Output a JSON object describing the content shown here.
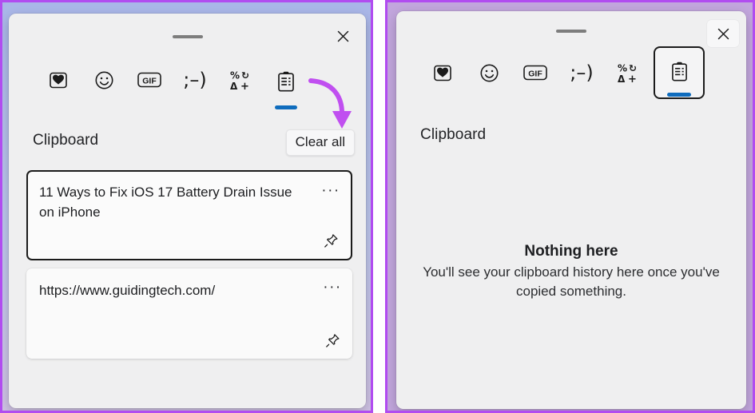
{
  "theme": {
    "accent_blue": "#0f6cbd",
    "annotation_purple": "#b14cf0",
    "frame_purple": "#b14cf0",
    "panel_bg": "#efeff0",
    "card_bg": "#fafafa"
  },
  "left_panel": {
    "window_title": "Clipboard",
    "close_label": "Close",
    "drag_handle_label": "Drag handle",
    "toolbar": [
      {
        "name": "recently-used-icon",
        "label": "Recently used"
      },
      {
        "name": "emoji-icon",
        "label": "Emoji"
      },
      {
        "name": "gif-icon",
        "label": "GIF"
      },
      {
        "name": "kaomoji-icon",
        "label": "Kaomoji"
      },
      {
        "name": "symbols-icon",
        "label": "Symbols"
      },
      {
        "name": "clipboard-icon",
        "label": "Clipboard history"
      }
    ],
    "active_tool_index": 5,
    "section_heading": "Clipboard",
    "clear_all_label": "Clear all",
    "items": [
      {
        "text": "11 Ways to Fix iOS 17 Battery Drain Issue on iPhone",
        "selected": true,
        "more_label": "···",
        "pin_label": "Pin item"
      },
      {
        "text": "https://www.guidingtech.com/",
        "selected": false,
        "more_label": "···",
        "pin_label": "Pin item"
      }
    ],
    "annotation": {
      "shape": "curved-down-arrow",
      "points_to": "Clear all",
      "color": "#b14cf0"
    }
  },
  "right_panel": {
    "window_title": "Clipboard",
    "close_label": "Close",
    "drag_handle_label": "Drag handle",
    "toolbar": [
      {
        "name": "recently-used-icon",
        "label": "Recently used"
      },
      {
        "name": "emoji-icon",
        "label": "Emoji"
      },
      {
        "name": "gif-icon",
        "label": "GIF"
      },
      {
        "name": "kaomoji-icon",
        "label": "Kaomoji"
      },
      {
        "name": "symbols-icon",
        "label": "Symbols"
      },
      {
        "name": "clipboard-icon",
        "label": "Clipboard history"
      }
    ],
    "active_tool_index": 5,
    "focused_tool_index": 5,
    "section_heading": "Clipboard",
    "empty_state": {
      "title": "Nothing here",
      "subtitle": "You'll see your clipboard history here once you've copied something."
    }
  }
}
